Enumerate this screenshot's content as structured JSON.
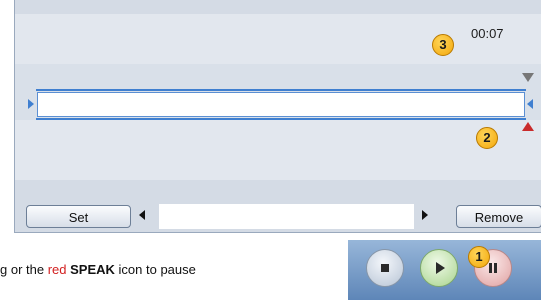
{
  "timer": {
    "value": "00:07"
  },
  "callouts": {
    "one": "1",
    "two": "2",
    "three": "3"
  },
  "controls": {
    "set_label": "Set",
    "remove_label": "Remove",
    "text_value": ""
  },
  "hint": {
    "prefix": "g or the ",
    "red_word": "red",
    "bold_word": "SPEAK",
    "suffix": " icon to pause"
  },
  "player": {
    "stop_icon": "stop-icon",
    "play_icon": "play-icon",
    "pause_icon": "pause-icon"
  },
  "colors": {
    "accent_blue": "#3f7fd0",
    "marker_red": "#c92b2b",
    "marker_gray": "#777777",
    "badge_orange": "#f3a70b"
  }
}
